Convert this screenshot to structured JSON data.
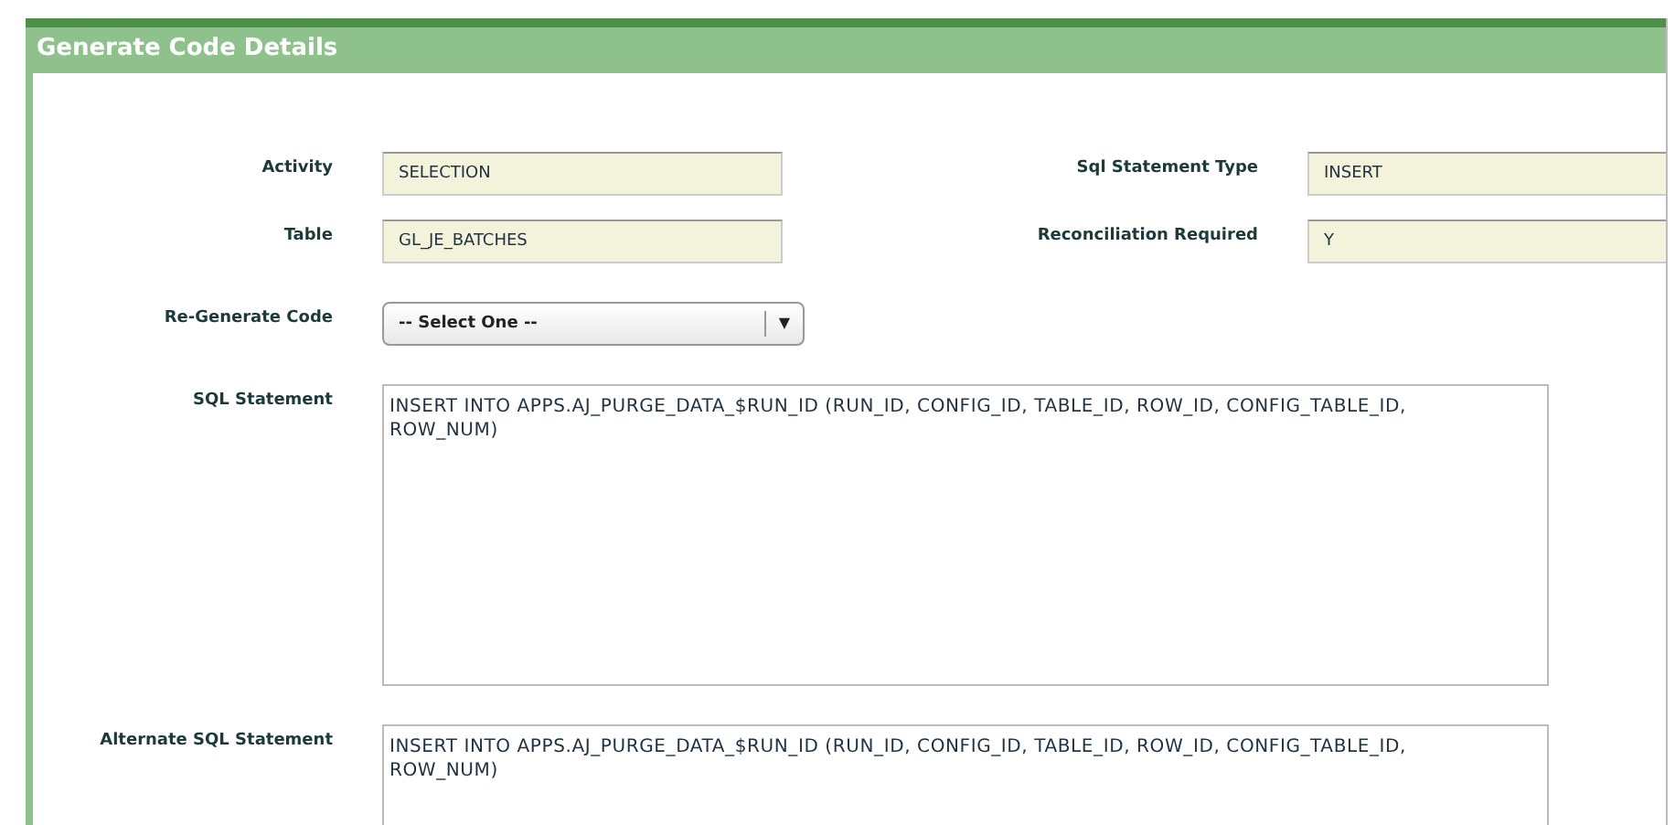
{
  "dialog": {
    "title": "Generate Code Details"
  },
  "fields": [
    {
      "label": "Activity",
      "value": "SELECTION"
    },
    {
      "label": "Sql Statement Type",
      "value": "INSERT"
    },
    {
      "label": "Table",
      "value": "GL_JE_BATCHES"
    },
    {
      "label": "Reconciliation Required",
      "value": "Y"
    }
  ],
  "regenerate": {
    "label": "Re-Generate Code",
    "value": "-- Select One --",
    "arrow": "▼"
  },
  "statements": [
    {
      "label": "SQL Statement",
      "value": "INSERT INTO APPS.AJ_PURGE_DATA_$RUN_ID (RUN_ID, CONFIG_ID, TABLE_ID, ROW_ID, CONFIG_TABLE_ID, ROW_NUM)"
    },
    {
      "label": "Alternate SQL Statement",
      "value": "INSERT INTO APPS.AJ_PURGE_DATA_$RUN_ID (RUN_ID, CONFIG_ID, TABLE_ID, ROW_ID, CONFIG_TABLE_ID, ROW_NUM)"
    }
  ]
}
